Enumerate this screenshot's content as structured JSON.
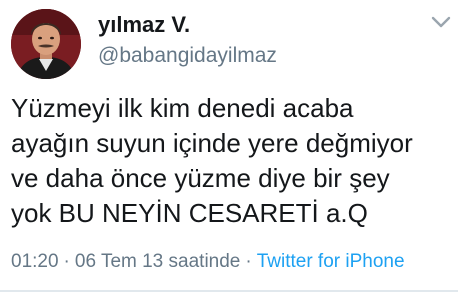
{
  "user": {
    "display_name": "yılmaz V.",
    "handle": "@babangidayilmaz",
    "avatar_icon": "profile-photo"
  },
  "tweet": {
    "text": "Yüzmeyi ilk kim denedi acaba\nayağın suyun içinde yere değmiyor\nve daha önce yüzme diye bir şey\nyok BU NEYİN CESARETİ a.Q",
    "time": "01:20",
    "separator": "·",
    "date": "06 Tem 13 saatinde",
    "source": "Twitter for iPhone"
  },
  "colors": {
    "text": "#14171a",
    "muted": "#657786",
    "link": "#1da1f2",
    "divider": "#e1e8ed"
  },
  "icons": {
    "menu": "chevron-down-icon"
  }
}
